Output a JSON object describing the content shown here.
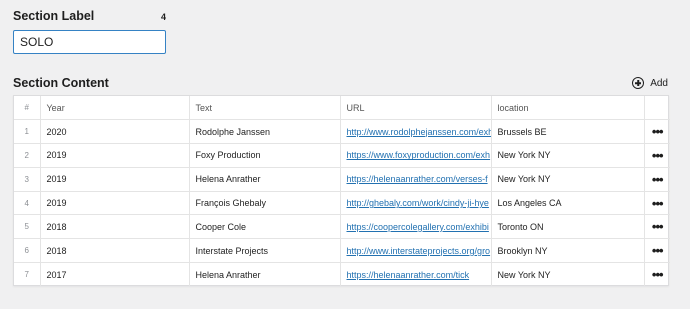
{
  "section_label": {
    "title": "Section Label",
    "char_count": "4",
    "value": "SOLO"
  },
  "section_content": {
    "title": "Section Content",
    "add_label": "Add",
    "columns": [
      "#",
      "Year",
      "Text",
      "URL",
      "location"
    ],
    "rows": [
      {
        "num": "1",
        "year": "2020",
        "text": "Rodolphe Janssen",
        "url": "http://www.rodolphejanssen.com/exh",
        "location": "Brussels BE"
      },
      {
        "num": "2",
        "year": "2019",
        "text": "Foxy Production",
        "url": "https://www.foxyproduction.com/exh",
        "location": "New York NY"
      },
      {
        "num": "3",
        "year": "2019",
        "text": "Helena Anrather",
        "url": "https://helenaanrather.com/verses-f",
        "location": "New York NY"
      },
      {
        "num": "4",
        "year": "2019",
        "text": "François Ghebaly",
        "url": "http://ghebaly.com/work/cindy-ji-hye",
        "location": "Los Angeles CA"
      },
      {
        "num": "5",
        "year": "2018",
        "text": "Cooper Cole",
        "url": "https://coopercolegallery.com/exhibi",
        "location": "Toronto ON"
      },
      {
        "num": "6",
        "year": "2018",
        "text": "Interstate Projects",
        "url": "http://www.interstateprojects.org/gro",
        "location": "Brooklyn NY"
      },
      {
        "num": "7",
        "year": "2017",
        "text": "Helena Anrather",
        "url": "https://helenaanrather.com/tick",
        "location": "New York NY"
      }
    ]
  },
  "colors": {
    "background": "#f0f0f1",
    "input_border": "#3582c4",
    "link": "#2271b1"
  },
  "icons": {
    "add": "plus-circle-icon",
    "row_action": "more-horizontal-icon"
  }
}
